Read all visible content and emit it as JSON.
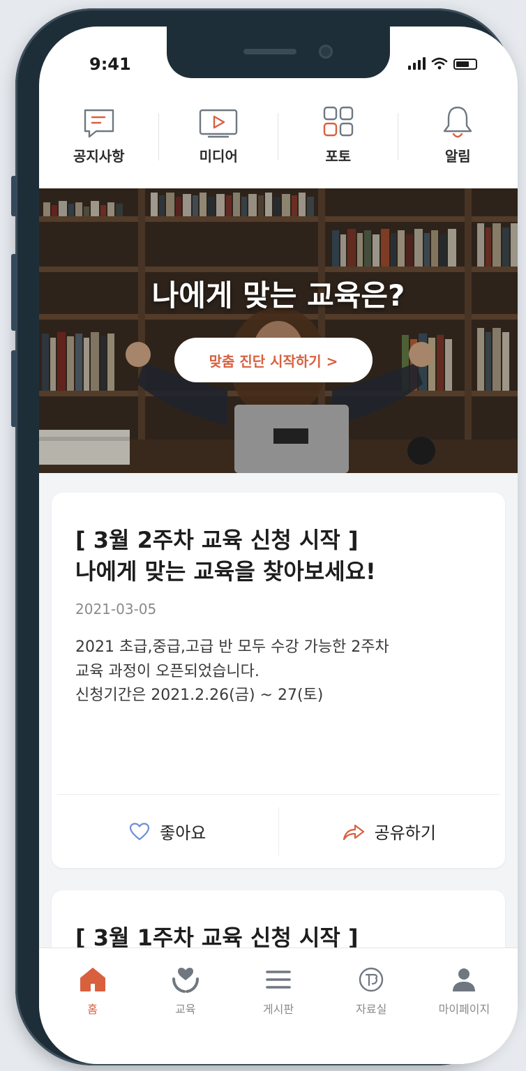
{
  "status_bar": {
    "time": "9:41"
  },
  "quick_menu": [
    {
      "label": "공지사항",
      "icon": "notice-icon"
    },
    {
      "label": "미디어",
      "icon": "media-icon"
    },
    {
      "label": "포토",
      "icon": "photo-grid-icon"
    },
    {
      "label": "알림",
      "icon": "bell-icon"
    }
  ],
  "banner": {
    "title": "나에게 맞는 교육은?",
    "cta_label": "맞춤 진단 시작하기  >"
  },
  "posts": [
    {
      "headline_line1": "[ 3월 2주차 교육 신청 시작 ]",
      "headline_line2": "나에게 맞는 교육을 찾아보세요!",
      "date": "2021-03-05",
      "body_line1": "2021 초급,중급,고급 반 모두 수강 가능한 2주차",
      "body_line2": "교육 과정이 오픈되었습니다.",
      "body_line3": "신청기간은 2021.2.26(금) ~ 27(토)",
      "like_label": "좋아요",
      "share_label": "공유하기"
    },
    {
      "headline_line1": "[ 3월 1주차 교육 신청 시작 ]"
    }
  ],
  "tabbar": [
    {
      "label": "홈",
      "icon": "home-icon",
      "active": true
    },
    {
      "label": "교육",
      "icon": "heart-hands-icon",
      "active": false
    },
    {
      "label": "게시판",
      "icon": "menu-lines-icon",
      "active": false
    },
    {
      "label": "자료실",
      "icon": "archive-icon",
      "active": false
    },
    {
      "label": "마이페이지",
      "icon": "user-icon",
      "active": false
    }
  ],
  "colors": {
    "accent": "#d8603e",
    "text": "#1d1d1d",
    "muted": "#8a8a8a",
    "icon_gray": "#6f7780"
  }
}
